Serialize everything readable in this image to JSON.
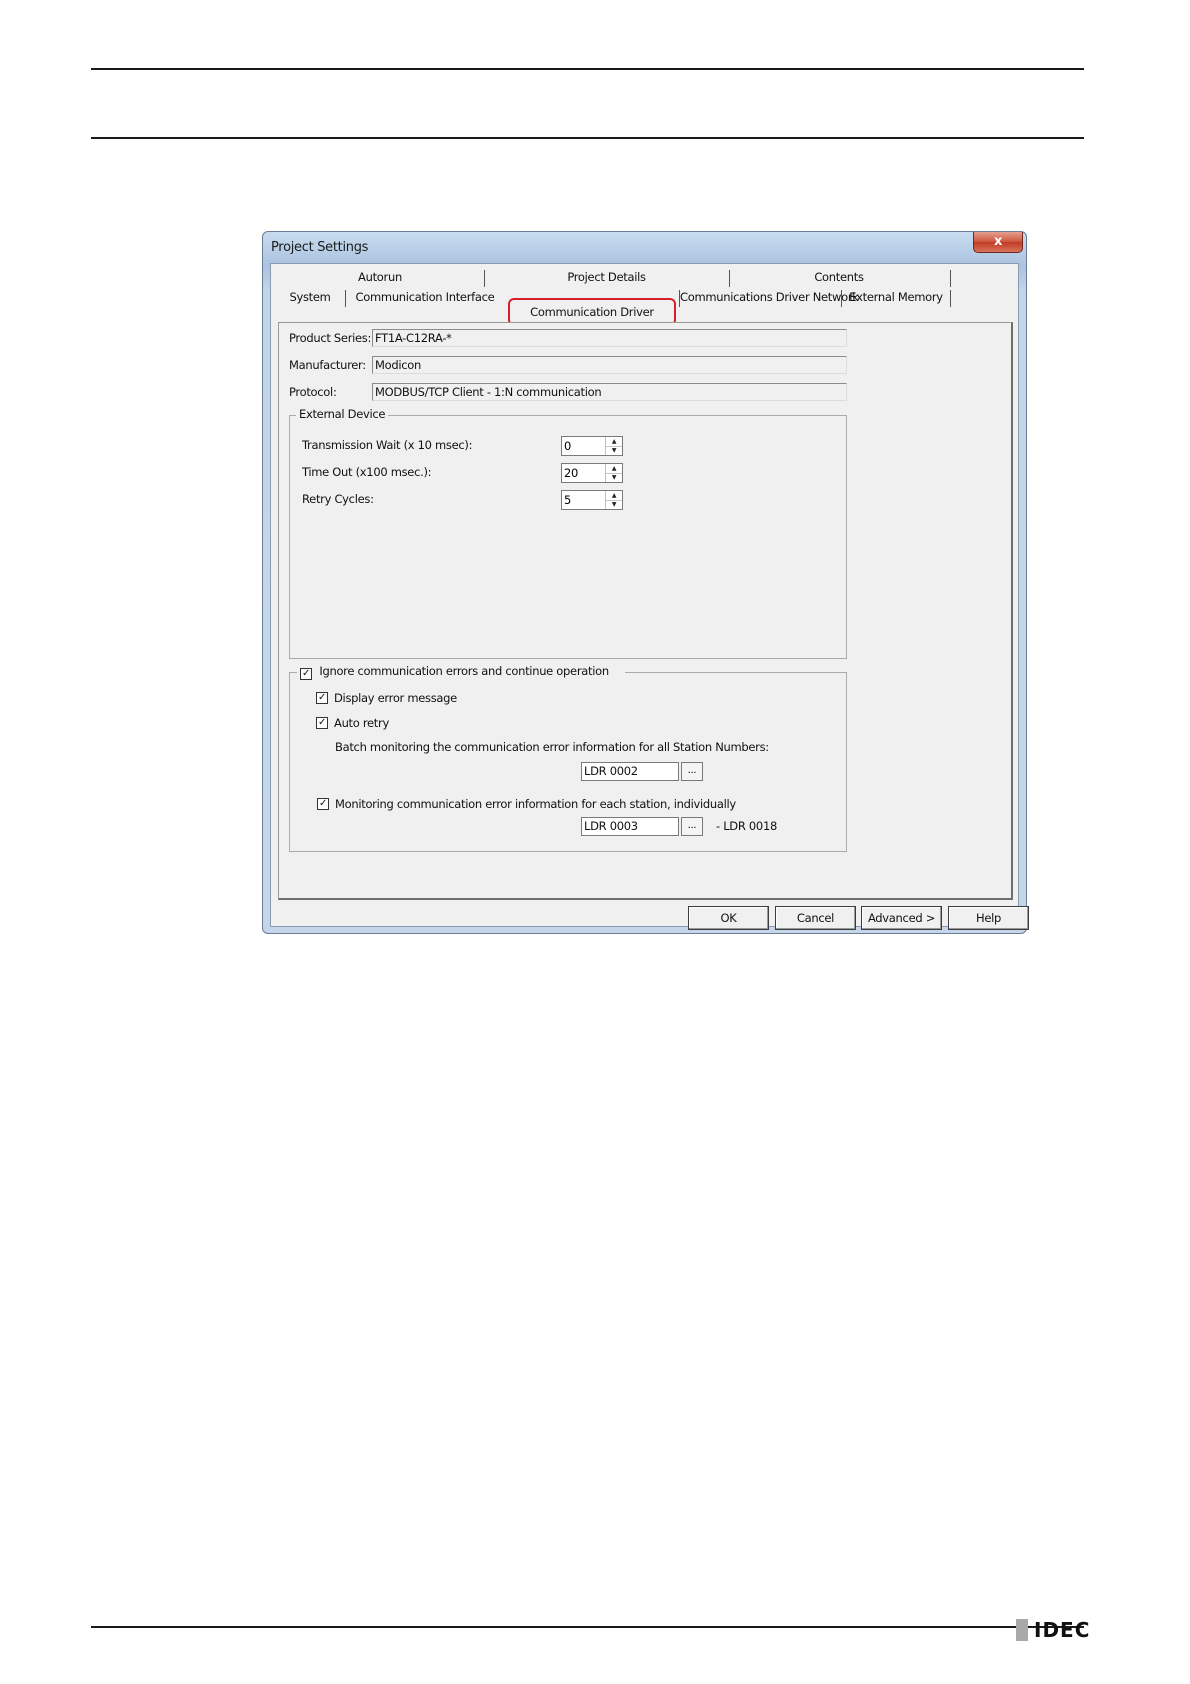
{
  "dialog": {
    "title": "Project Settings",
    "close_glyph": "x",
    "tabs_row1": [
      "Autorun",
      "Project Details",
      "Contents"
    ],
    "tabs_row2": [
      "System",
      "Communication Interface",
      "Communication Driver",
      "Communications Driver Network",
      "External Memory"
    ],
    "active_tab": "Communication Driver",
    "product_series": {
      "label": "Product Series:",
      "value": "FT1A-C12RA-*"
    },
    "manufacturer": {
      "label": "Manufacturer:",
      "value": "Modicon"
    },
    "protocol": {
      "label": "Protocol:",
      "value": "MODBUS/TCP Client - 1:N communication"
    },
    "external_device": {
      "legend": "External Device",
      "transmission_wait": {
        "label": "Transmission Wait (x 10 msec):",
        "value": "0"
      },
      "time_out": {
        "label": "Time Out (x100 msec.):",
        "value": "20"
      },
      "retry_cycles": {
        "label": "Retry Cycles:",
        "value": "5"
      }
    },
    "error_group": {
      "ignore_errors": {
        "label": "Ignore communication errors and continue operation",
        "checked": true
      },
      "display_error": {
        "label": "Display error message",
        "checked": true
      },
      "auto_retry": {
        "label": "Auto retry",
        "checked": true
      },
      "batch_text": "Batch monitoring the communication error information for all Station Numbers:",
      "batch_device": "LDR 0002",
      "monitor_each": {
        "label": "Monitoring communication error information for each station, individually",
        "checked": true
      },
      "monitor_device": "LDR 0003",
      "monitor_range_end": "-  LDR 0018",
      "browse_label": "..."
    },
    "buttons": {
      "ok": "OK",
      "cancel": "Cancel",
      "advanced": "Advanced >",
      "help": "Help"
    }
  },
  "footer": {
    "logo_text": "IDEC"
  },
  "colors": {
    "highlight": "#d6212b",
    "dialog_face": "#f0f0f0",
    "title_bar": "#b7cde6",
    "close_button": "#c13b22"
  }
}
